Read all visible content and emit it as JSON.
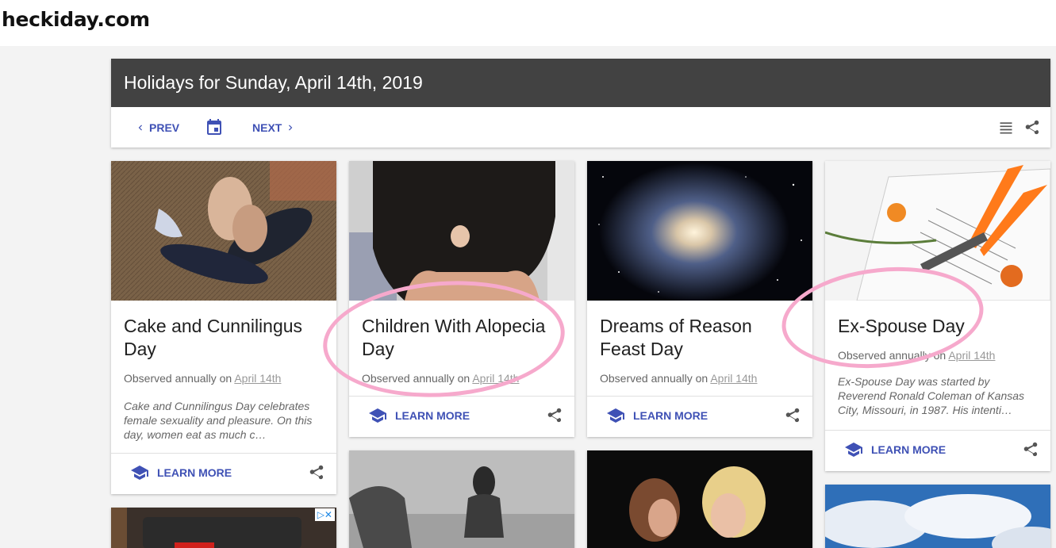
{
  "site": {
    "title": "heckiday.com"
  },
  "header": {
    "title": "Holidays for Sunday, April 14th, 2019",
    "prev_label": "PREV",
    "next_label": "NEXT",
    "icons": [
      "chevron-left-icon",
      "calendar-icon",
      "chevron-right-icon",
      "list-icon",
      "share-icon"
    ]
  },
  "cards": [
    {
      "title": "Cake and Cunnilingus Day",
      "observed_prefix": "Observed annually on",
      "date": "April 14th",
      "description": "Cake and Cunnilingus Day celebrates female sexuality and pleasure. On this day, women eat as much c…",
      "learn_more": "LEARN MORE"
    },
    {
      "title": "Children With Alopecia Day",
      "observed_prefix": "Observed annually on",
      "date": "April 14th",
      "learn_more": "LEARN MORE"
    },
    {
      "title": "Dreams of Reason Feast Day",
      "observed_prefix": "Observed annually on",
      "date": "April 14th",
      "learn_more": "LEARN MORE"
    },
    {
      "title": "Ex-Spouse Day",
      "observed_prefix": "Observed annually on",
      "date": "April 14th",
      "description": "Ex-Spouse Day was started by Reverend Ronald Coleman of Kansas City, Missouri, in 1987. His intenti…",
      "learn_more": "LEARN MORE"
    }
  ],
  "ad": {
    "badge": "▷✕"
  },
  "colors": {
    "accent": "#3f51b5",
    "header_bg": "#424242",
    "annotation": "#f6a9cc",
    "page_bg": "#f3f3f3"
  }
}
